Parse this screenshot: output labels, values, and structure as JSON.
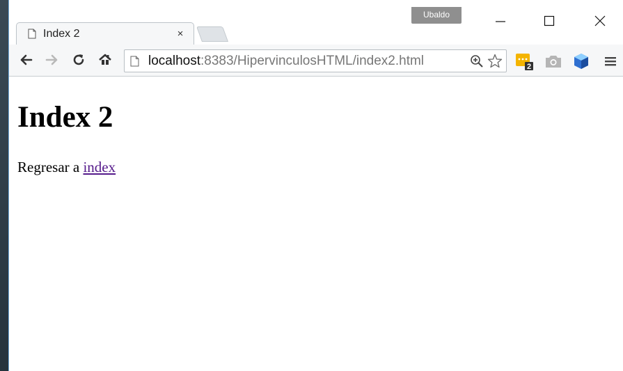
{
  "profile": {
    "name": "Ubaldo"
  },
  "tab": {
    "title": "Index 2",
    "close_label": "×"
  },
  "omnibox": {
    "host": "localhost",
    "rest": ":8383/HipervinculosHTML/index2.html"
  },
  "extensions": {
    "badge_count": "2"
  },
  "page": {
    "title": "Index 2",
    "para_text": "Regresar a",
    "link_label": "index"
  },
  "colors": {
    "link_visited": "#551a8b",
    "extension_yellow": "#f4b400",
    "badge_dark": "#333333"
  }
}
